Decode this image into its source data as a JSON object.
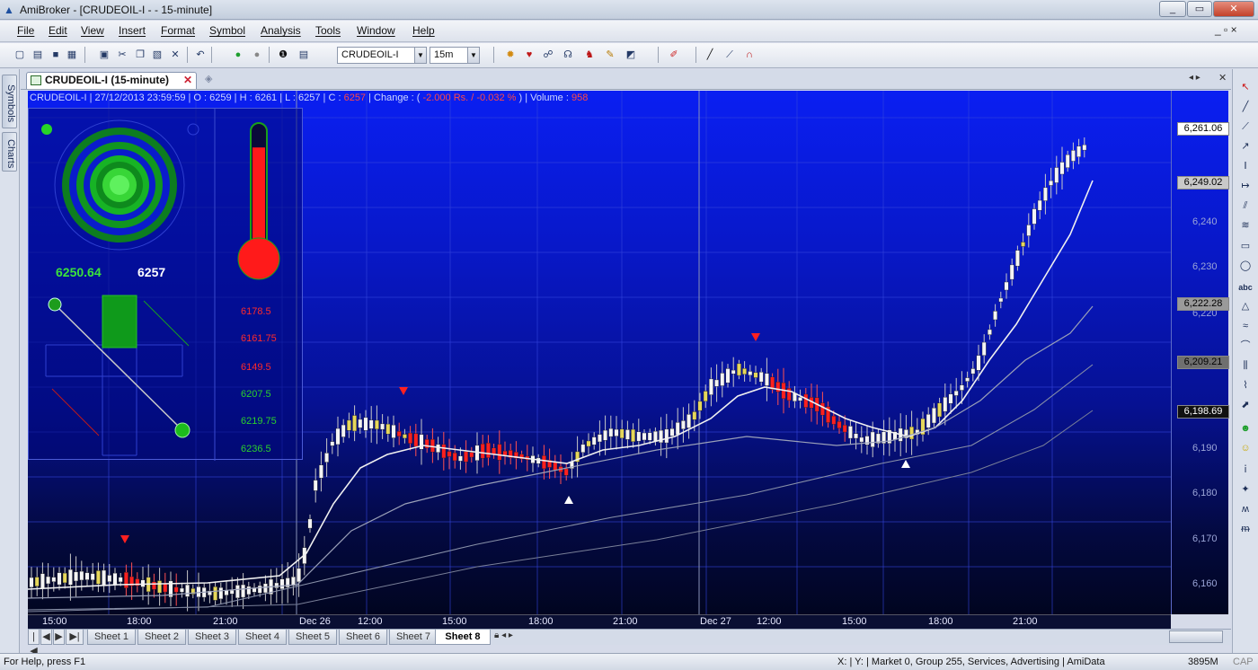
{
  "window": {
    "title": "AmiBroker - [CRUDEOIL-I - - 15-minute]",
    "min": "_",
    "max": "▭",
    "close": "✕"
  },
  "menu": {
    "items": [
      "File",
      "Edit",
      "View",
      "Insert",
      "Format",
      "Symbol",
      "Analysis",
      "Tools",
      "Window",
      "Help"
    ],
    "mdi": "_ ▫ ×"
  },
  "toolbar": {
    "symbol": "CRUDEOIL-I",
    "interval": "15m"
  },
  "side_tabs": {
    "symbols": "Symbols",
    "charts": "Charts"
  },
  "doc_tab": {
    "label": "CRUDEOIL-I (15-minute)"
  },
  "info": {
    "prefix": "CRUDEOIL-I | 27/12/2013 23:59:59 | O : 6259 | H : 6261 | L : 6257 | C : ",
    "close": "6257",
    "change_label": " | Change : (",
    "change_val": " -2.000 Rs. /  -0.032 % ",
    "tail": ") | Volume : ",
    "volume": "958"
  },
  "panel": {
    "value_green": "6250.64",
    "value_white": "6257",
    "levels": [
      {
        "v": "6178.5",
        "c": "#ff2a2a"
      },
      {
        "v": "6161.75",
        "c": "#ff2a2a"
      },
      {
        "v": "6149.5",
        "c": "#ff2a2a"
      },
      {
        "v": "6207.5",
        "c": "#2bd02b"
      },
      {
        "v": "6219.75",
        "c": "#2bd02b"
      },
      {
        "v": "6236.5",
        "c": "#2bd02b"
      }
    ],
    "thermometer_level": 0.82
  },
  "y_axis": {
    "ticks": [
      "6,240",
      "6,230",
      "6,220",
      "6,190",
      "6,180",
      "6,170",
      "6,160"
    ],
    "boxes": [
      {
        "v": "6,261.06",
        "bg": "#ffffff",
        "fg": "#000000"
      },
      {
        "v": "6,249.02",
        "bg": "#c9c9c9",
        "fg": "#000000"
      },
      {
        "v": "6,222.28",
        "bg": "#9a9a9a",
        "fg": "#000000"
      },
      {
        "v": "6,209.21",
        "bg": "#6f6f6f",
        "fg": "#000000"
      },
      {
        "v": "6,198.69",
        "bg": "#111111",
        "fg": "#ffffff"
      }
    ]
  },
  "x_axis": {
    "labels": [
      "15:00",
      "18:00",
      "21:00",
      "Dec 26",
      "12:00",
      "15:00",
      "18:00",
      "21:00",
      "Dec 27",
      "12:00",
      "15:00",
      "18:00",
      "21:00"
    ]
  },
  "sheets": {
    "nav": [
      "|◀",
      "◀",
      "▶",
      "▶|"
    ],
    "items": [
      "Sheet 1",
      "Sheet 2",
      "Sheet 3",
      "Sheet 4",
      "Sheet 5",
      "Sheet 6",
      "Sheet 7",
      "Sheet 8"
    ],
    "active": 7
  },
  "status": {
    "help": "For Help, press F1",
    "xy": "X: | Y: | Market 0, Group 255, Services, Advertising | AmiData",
    "mem": "3895M",
    "cap": "CAP"
  }
}
